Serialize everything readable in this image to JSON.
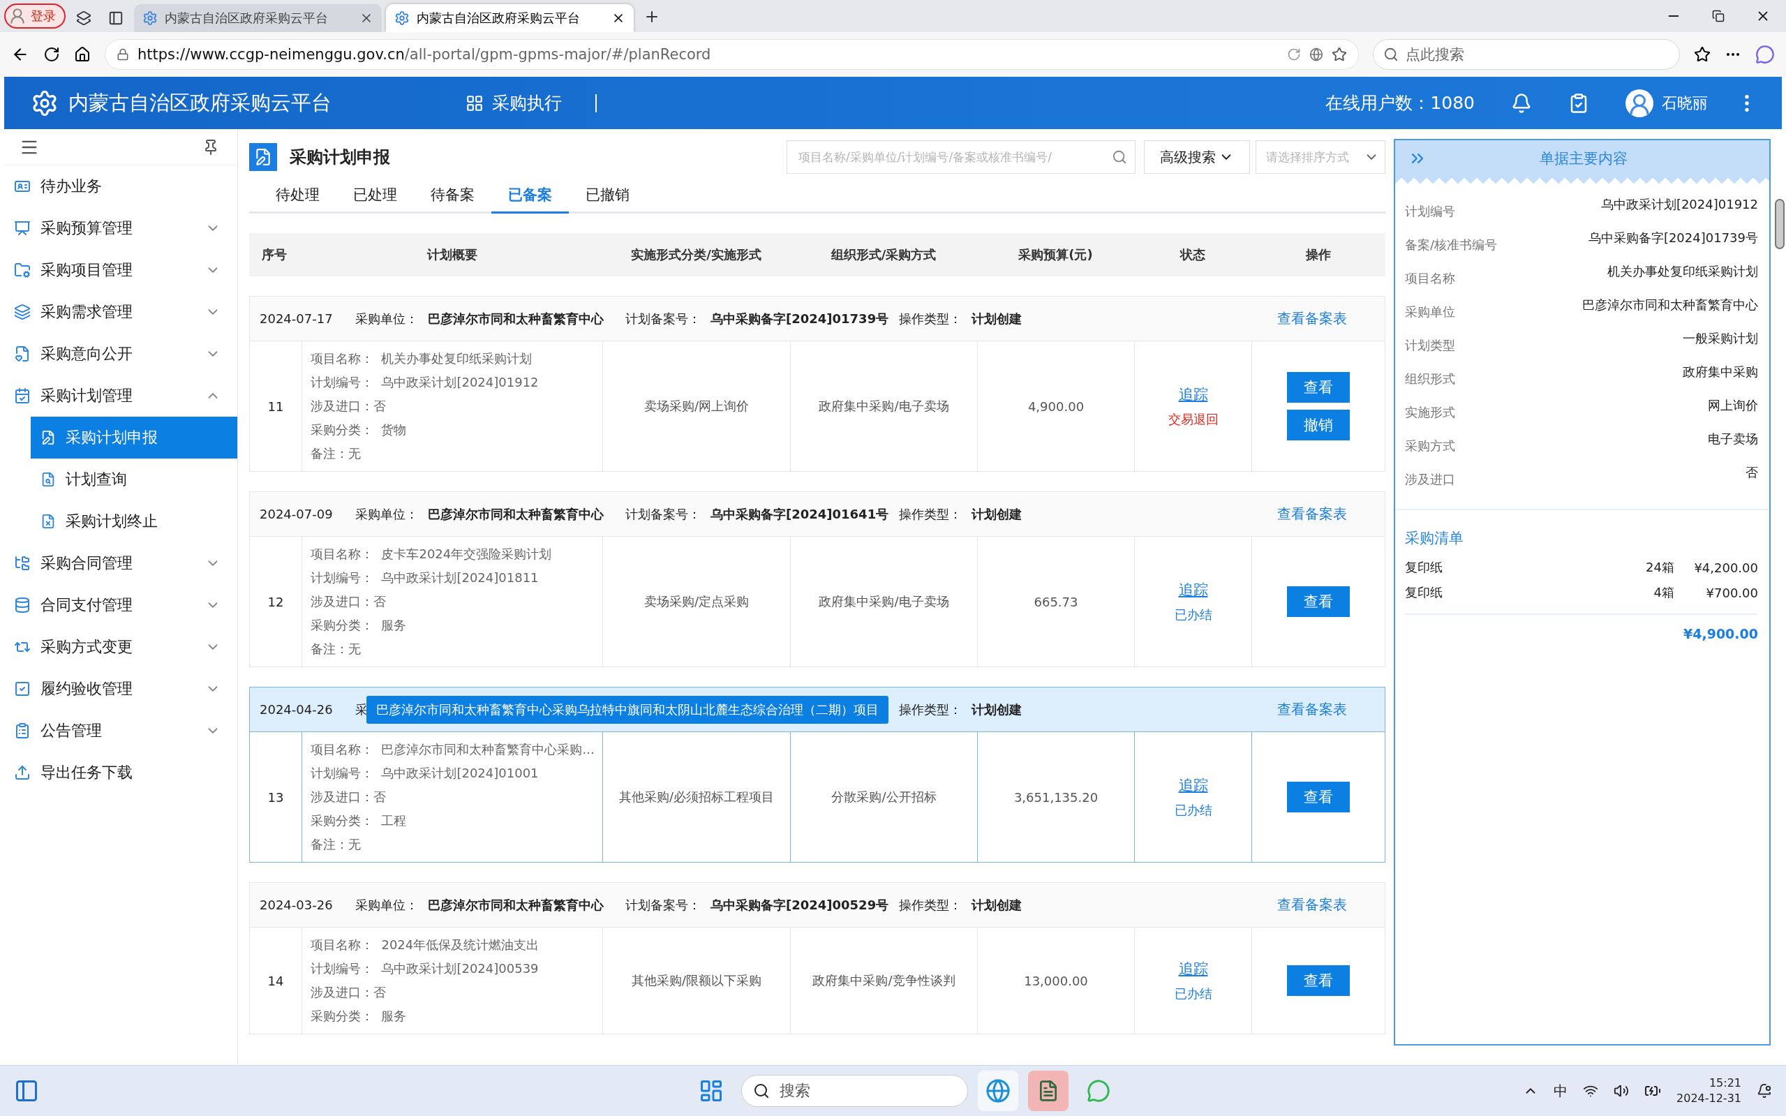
{
  "browser": {
    "profile": "登录",
    "tabs": [
      {
        "title": "内蒙古自治区政府采购云平台",
        "selected": false
      },
      {
        "title": "内蒙古自治区政府采购云平台",
        "selected": true
      }
    ],
    "url_host": "https://www.ccgp-neimenggu.gov.cn",
    "url_path": "/all-portal/gpm-gpms-major/#/planRecord",
    "search_placeholder": "点此搜索"
  },
  "header": {
    "title": "内蒙古自治区政府采购云平台",
    "module": "采购执行",
    "online": "在线用户数：1080",
    "user": "石晓丽"
  },
  "sidebar": {
    "items": [
      {
        "label": "待办业务",
        "selected": false
      },
      {
        "label": "采购预算管理",
        "selected": false,
        "expanded": false
      },
      {
        "label": "采购项目管理",
        "selected": false,
        "expanded": false
      },
      {
        "label": "采购需求管理",
        "selected": false,
        "expanded": false
      },
      {
        "label": "采购意向公开",
        "selected": false,
        "expanded": false
      },
      {
        "label": "采购计划管理",
        "selected": false,
        "expanded": true,
        "children": [
          {
            "label": "采购计划申报",
            "selected": true
          },
          {
            "label": "计划查询",
            "selected": false
          },
          {
            "label": "采购计划终止",
            "selected": false
          }
        ]
      },
      {
        "label": "采购合同管理",
        "selected": false,
        "expanded": false
      },
      {
        "label": "合同支付管理",
        "selected": false,
        "expanded": false
      },
      {
        "label": "采购方式变更",
        "selected": false,
        "expanded": false
      },
      {
        "label": "履约验收管理",
        "selected": false,
        "expanded": false
      },
      {
        "label": "公告管理",
        "selected": false,
        "expanded": false
      },
      {
        "label": "导出任务下载",
        "selected": false
      }
    ]
  },
  "page": {
    "title": "采购计划申报",
    "search": {
      "placeholder": "项目名称/采购单位/计划编号/备案或核准书编号/"
    },
    "advanced": "高级搜索",
    "sort": {
      "placeholder": "请选择排序方式"
    },
    "tabs": [
      {
        "label": "待处理",
        "selected": false
      },
      {
        "label": "已处理",
        "selected": false
      },
      {
        "label": "待备案",
        "selected": false
      },
      {
        "label": "已备案",
        "selected": true
      },
      {
        "label": "已撤销",
        "selected": false
      }
    ]
  },
  "table": {
    "columns": [
      "序号",
      "计划概要",
      "实施形式分类/实施形式",
      "组织形式/采购方式",
      "采购预算(元)",
      "状态",
      "操作"
    ],
    "records": [
      {
        "date": "2024-07-17",
        "unit": {
          "label": "采购单位：",
          "value": "巴彦淖尔市同和太种畜繁育中心"
        },
        "filing": {
          "label": "计划备案号：",
          "value": "乌中采购备字[2024]01739号"
        },
        "op": {
          "label": "操作类型：",
          "value": "计划创建"
        },
        "link": "查看备案表",
        "selected": false,
        "no": "11",
        "details": [
          "项目名称：  机关办事处复印纸采购计划",
          "计划编号：  乌中政采计划[2024]01912",
          "涉及进口：否",
          "采购分类：  货物",
          "备注：无"
        ],
        "form": "卖场采购/网上询价",
        "org": "政府集中采购/电子卖场",
        "budget": "4,900.00",
        "track": "追踪",
        "status": {
          "text": "交易退回",
          "kind": "returned"
        },
        "actions": [
          "查看",
          "撤销"
        ]
      },
      {
        "date": "2024-07-09",
        "unit": {
          "label": "采购单位：",
          "value": "巴彦淖尔市同和太种畜繁育中心"
        },
        "filing": {
          "label": "计划备案号：",
          "value": "乌中采购备字[2024]01641号"
        },
        "op": {
          "label": "操作类型：",
          "value": "计划创建"
        },
        "link": "查看备案表",
        "selected": false,
        "no": "12",
        "details": [
          "项目名称：  皮卡车2024年交强险采购计划",
          "计划编号：  乌中政采计划[2024]01811",
          "涉及进口：否",
          "采购分类：  服务",
          "备注：无"
        ],
        "form": "卖场采购/定点采购",
        "org": "政府集中采购/电子卖场",
        "budget": "665.73",
        "track": "追踪",
        "status": {
          "text": "已办结",
          "kind": "done"
        },
        "actions": [
          "查看"
        ]
      },
      {
        "date": "2024-04-26",
        "unit": {
          "label": "采"
        },
        "op": {
          "label": "操作类型：",
          "value": "计划创建"
        },
        "link": "查看备案表",
        "selected": true,
        "tooltip": "巴彦淖尔市同和太种畜繁育中心采购乌拉特中旗同和太阴山北麓生态综合治理（二期）项目",
        "no": "13",
        "details": [
          "项目名称：  巴彦淖尔市同和太种畜繁育中心采购...",
          "计划编号：  乌中政采计划[2024]01001",
          "涉及进口：否",
          "采购分类：  工程",
          "备注：无"
        ],
        "form": "其他采购/必须招标工程项目",
        "org": "分散采购/公开招标",
        "budget": "3,651,135.20",
        "track": "追踪",
        "status": {
          "text": "已办结",
          "kind": "done"
        },
        "actions": [
          "查看"
        ]
      },
      {
        "date": "2024-03-26",
        "unit": {
          "label": "采购单位：",
          "value": "巴彦淖尔市同和太种畜繁育中心"
        },
        "filing": {
          "label": "计划备案号：",
          "value": "乌中采购备字[2024]00529号"
        },
        "op": {
          "label": "操作类型：",
          "value": "计划创建"
        },
        "link": "查看备案表",
        "selected": false,
        "no": "14",
        "details": [
          "项目名称：  2024年低保及统计燃油支出",
          "计划编号：  乌中政采计划[2024]00539",
          "涉及进口：否",
          "采购分类：  服务"
        ],
        "form": "其他采购/限额以下采购",
        "org": "政府集中采购/竞争性谈判",
        "budget": "13,000.00",
        "track": "追踪",
        "status": {
          "text": "已办结",
          "kind": "done"
        },
        "actions": [
          "查看"
        ]
      }
    ]
  },
  "detail_panel": {
    "title": "单据主要内容",
    "fields": [
      {
        "label": "计划编号",
        "value": "乌中政采计划[2024]01912"
      },
      {
        "label": "备案/核准书编号",
        "value": "乌中采购备字[2024]01739号"
      },
      {
        "label": "项目名称",
        "value": "机关办事处复印纸采购计划"
      },
      {
        "label": "采购单位",
        "value": "巴彦淖尔市同和太种畜繁育中心"
      },
      {
        "label": "计划类型",
        "value": "一般采购计划"
      },
      {
        "label": "组织形式",
        "value": "政府集中采购"
      },
      {
        "label": "实施形式",
        "value": "网上询价"
      },
      {
        "label": "采购方式",
        "value": "电子卖场"
      },
      {
        "label": "涉及进口",
        "value": "否"
      }
    ],
    "list_title": "采购清单",
    "items": [
      {
        "name": "复印纸",
        "qty": "24箱",
        "price": "¥4,200.00"
      },
      {
        "name": "复印纸",
        "qty": "4箱",
        "price": "¥700.00"
      }
    ],
    "total": "¥4,900.00"
  },
  "taskbar": {
    "search_placeholder": "搜索",
    "ime": "中",
    "time": "15:21",
    "date": "2024-12-31"
  }
}
